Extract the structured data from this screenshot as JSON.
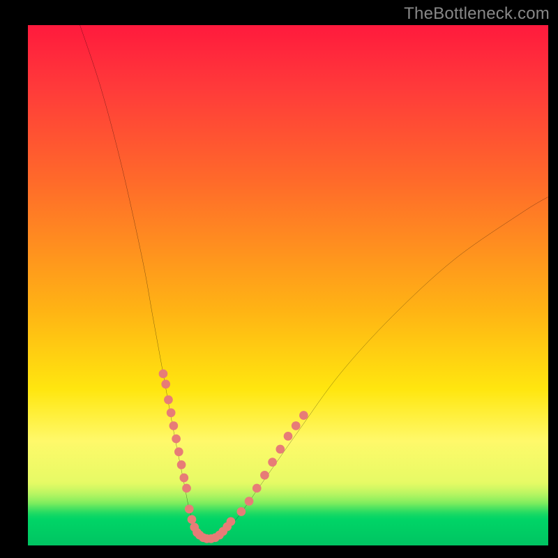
{
  "watermark": "TheBottleneck.com",
  "colors": {
    "frame": "#000000",
    "gradient_top": "#ff1a3d",
    "gradient_mid": "#ffe60f",
    "gradient_bottom": "#00c462",
    "curve": "#000000",
    "dots": "#e77c77"
  },
  "chart_data": {
    "type": "line",
    "title": "",
    "xlabel": "",
    "ylabel": "",
    "xlim": [
      0,
      100
    ],
    "ylim": [
      0,
      100
    ],
    "series": [
      {
        "name": "bottleneck-curve",
        "x": [
          10,
          14,
          18,
          22,
          24,
          26,
          28,
          30,
          31,
          32,
          33,
          34,
          35,
          37,
          40,
          45,
          52,
          60,
          70,
          82,
          95,
          100
        ],
        "values": [
          100,
          88,
          73,
          55,
          44,
          33,
          22,
          12,
          7,
          4,
          2,
          1,
          1,
          2,
          5,
          12,
          22,
          33,
          44,
          55,
          64,
          67
        ]
      }
    ],
    "dot_clusters": [
      {
        "name": "left-descending-cluster",
        "points": [
          [
            26,
            33
          ],
          [
            26.5,
            31
          ],
          [
            27,
            28
          ],
          [
            27.5,
            25.5
          ],
          [
            28,
            23
          ],
          [
            28.5,
            20.5
          ],
          [
            29,
            18
          ],
          [
            29.5,
            15.5
          ],
          [
            30,
            13
          ],
          [
            30.5,
            11
          ]
        ]
      },
      {
        "name": "valley-cluster",
        "points": [
          [
            31,
            7
          ],
          [
            31.5,
            5
          ],
          [
            32,
            3.5
          ],
          [
            32.5,
            2.5
          ],
          [
            33,
            2
          ],
          [
            33.7,
            1.5
          ],
          [
            34.4,
            1.3
          ],
          [
            35.2,
            1.3
          ],
          [
            36,
            1.5
          ],
          [
            36.8,
            2
          ],
          [
            37.5,
            2.7
          ],
          [
            38.3,
            3.6
          ],
          [
            39,
            4.6
          ]
        ]
      },
      {
        "name": "right-ascending-cluster",
        "points": [
          [
            41,
            6.5
          ],
          [
            42.5,
            8.5
          ],
          [
            44,
            11
          ],
          [
            45.5,
            13.5
          ],
          [
            47,
            16
          ],
          [
            48.5,
            18.5
          ],
          [
            50,
            21
          ],
          [
            51.5,
            23
          ],
          [
            53,
            25
          ]
        ]
      }
    ]
  }
}
